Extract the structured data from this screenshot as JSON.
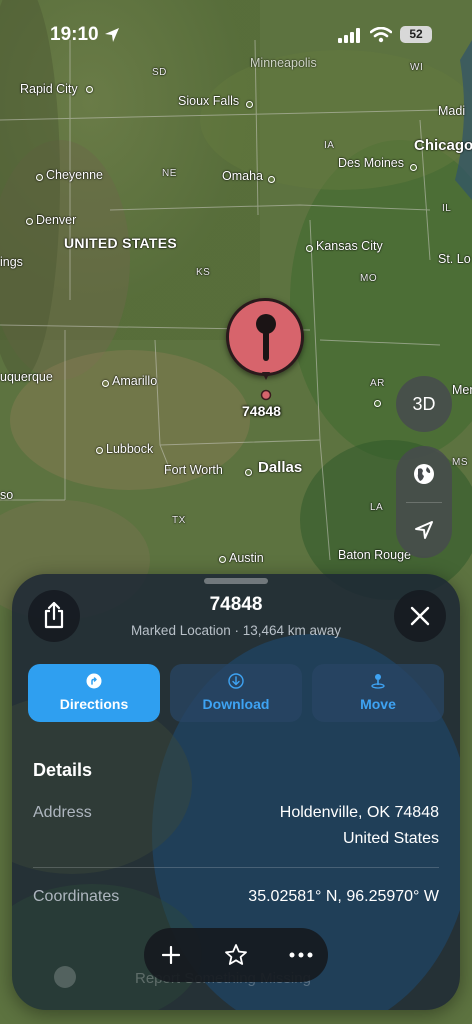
{
  "status_bar": {
    "time": "19:10",
    "battery": "52"
  },
  "map": {
    "labels": {
      "minneapolis": "Minneapolis",
      "sd": "SD",
      "wi": "WI",
      "rapid_city": "Rapid City",
      "sioux_falls": "Sioux Falls",
      "madison": "Madi",
      "chicago": "Chicago",
      "ia": "IA",
      "des_moines": "Des Moines",
      "cheyenne": "Cheyenne",
      "ne": "NE",
      "omaha": "Omaha",
      "il": "IL",
      "denver": "Denver",
      "united_states": "UNITED STATES",
      "kansas_city": "Kansas City",
      "springs": "ings",
      "st_louis": "St. Lo",
      "ks": "KS",
      "mo": "MO",
      "albuquerque": "uquerque",
      "amarillo": "Amarillo",
      "ar": "AR",
      "memphis": "Mem",
      "lubbock": "Lubbock",
      "ms": "MS",
      "fort_worth": "Fort Worth",
      "dallas": "Dallas",
      "el_paso": "so",
      "tx": "TX",
      "la": "LA",
      "austin": "Austin",
      "baton_rouge": "Baton Rouge"
    },
    "pin_label": "74848",
    "btn_3d": "3D"
  },
  "sheet": {
    "title": "74848",
    "subtitle": "Marked Location · 13,464 km away",
    "actions": {
      "directions": "Directions",
      "download": "Download",
      "move": "Move"
    },
    "details_heading": "Details",
    "address_label": "Address",
    "address_line1": "Holdenville, OK  74848",
    "address_line2": "United States",
    "coordinates_label": "Coordinates",
    "coordinates_value": "35.02581° N, 96.25970° W",
    "footer_text": "Report Something Missing"
  },
  "colors": {
    "accent": "#2f9ff0",
    "pin": "#d7646c"
  }
}
